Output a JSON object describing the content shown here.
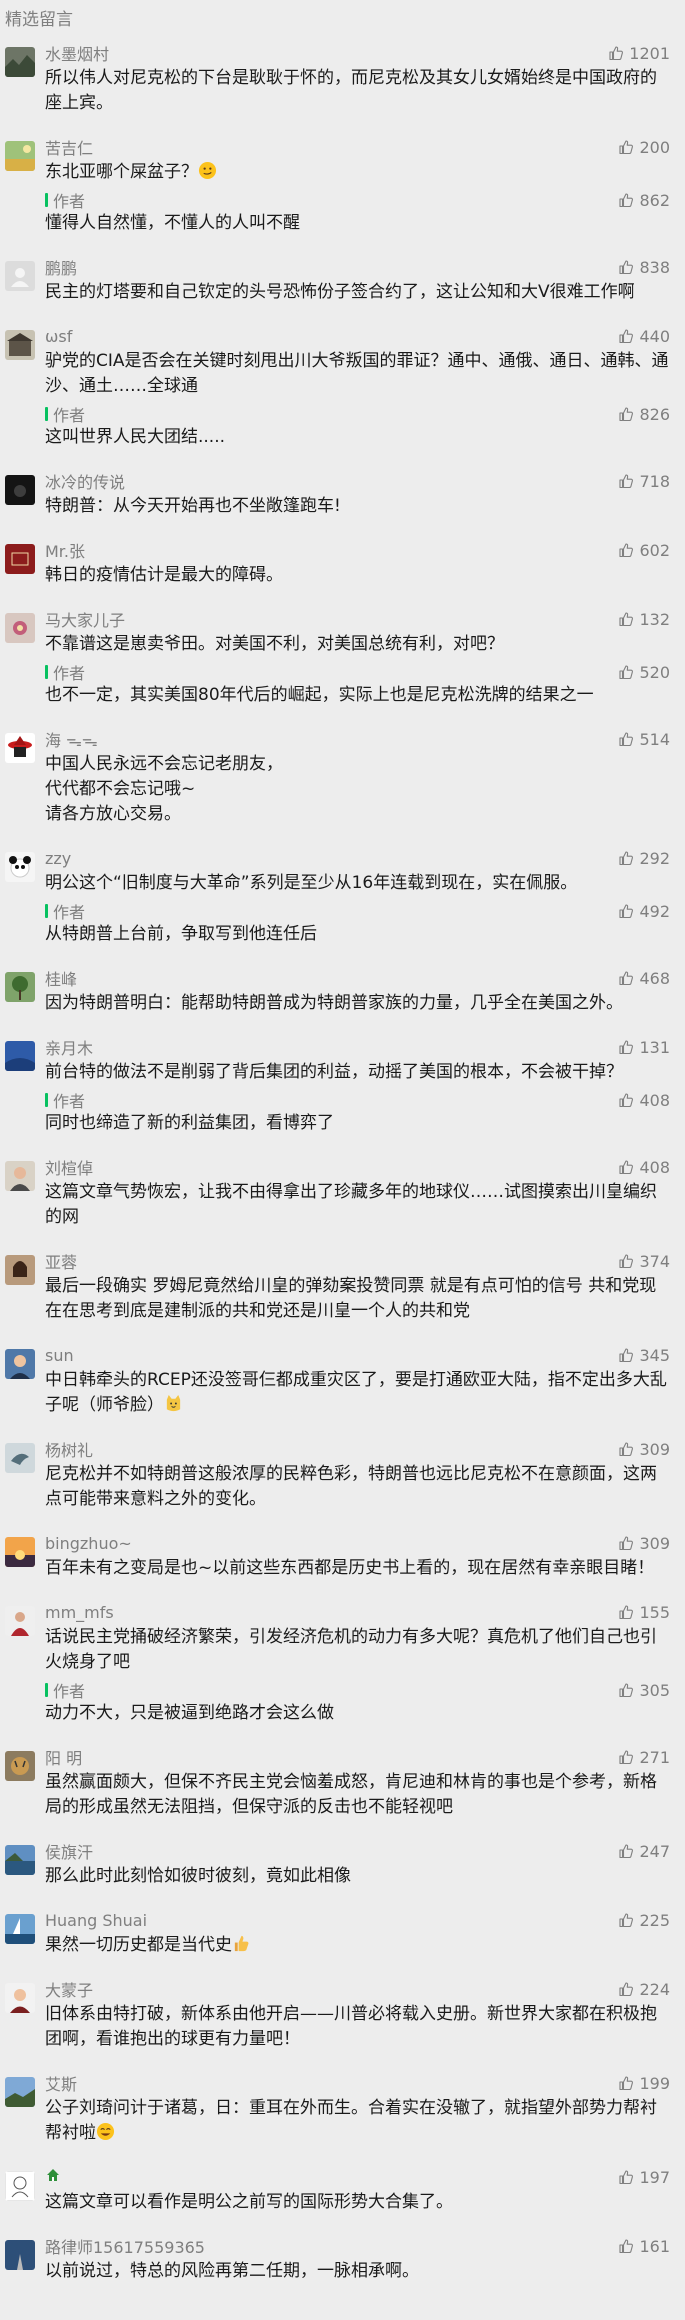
{
  "header": {
    "title": "精选留言"
  },
  "reply_author_label": "作者",
  "comments": [
    {
      "nick": "水墨烟村",
      "likes": "1201",
      "text": "所以伟人对尼克松的下台是耿耿于怀的，而尼克松及其女儿女婿始终是中国政府的座上宾。",
      "avatar": "landscape-avatar"
    },
    {
      "nick": "苦吉仁",
      "likes": "200",
      "text": "东北亚哪个屎盆子？",
      "emoji": "smirk-emoji",
      "reply": {
        "likes": "862",
        "text": "懂得人自然懂，不懂人的人叫不醒"
      },
      "avatar": "field-avatar"
    },
    {
      "nick": "鹏鹏",
      "likes": "838",
      "text": "民主的灯塔要和自己钦定的头号恐怖份子签合约了，这让公知和大V很难工作啊",
      "avatar": "default-avatar"
    },
    {
      "nick": "ωsf",
      "likes": "440",
      "text": "驴党的CIA是否会在关键时刻甩出川大爷叛国的罪证？通中、通俄、通日、通韩、通沙、通土……全球通",
      "reply": {
        "likes": "826",
        "text": "这叫世界人民大团结....."
      },
      "avatar": "building-avatar"
    },
    {
      "nick": "冰冷的传说",
      "likes": "718",
      "text": "特朗普：从今天开始再也不坐敞篷跑车!",
      "avatar": "dark-avatar"
    },
    {
      "nick": "Mr.张",
      "likes": "602",
      "text": "韩日的疫情估计是最大的障碍。",
      "avatar": "red-seal-avatar"
    },
    {
      "nick": "马大家儿子",
      "likes": "132",
      "text": "不靠谱这是崽卖爷田。对美国不利，对美国总统有利，对吧？",
      "reply": {
        "likes": "520",
        "text": "也不一定，其实美国80年代后的崛起，实际上也是尼克松洗牌的结果之一"
      },
      "avatar": "flower-avatar"
    },
    {
      "nick": "海 ᯓᯓ",
      "likes": "514",
      "text": "中国人民永远不会忘记老朋友，\n代代都不会忘记哦~\n请各方放心交易。",
      "avatar": "hat-avatar"
    },
    {
      "nick": "zzy",
      "likes": "292",
      "text": "明公这个“旧制度与大革命”系列是至少从16年连载到现在，实在佩服。",
      "reply": {
        "likes": "492",
        "text": "从特朗普上台前，争取写到他连任后"
      },
      "avatar": "panda-avatar"
    },
    {
      "nick": "桂峰",
      "likes": "468",
      "text": "因为特朗普明白：能帮助特朗普成为特朗普家族的力量，几乎全在美国之外。",
      "avatar": "tree-avatar"
    },
    {
      "nick": "亲月木",
      "likes": "131",
      "text": "前台特的做法不是削弱了背后集团的利益，动摇了美国的根本，不会被干掉？",
      "reply": {
        "likes": "408",
        "text": "同时也缔造了新的利益集团，看博弈了"
      },
      "avatar": "blue-avatar"
    },
    {
      "nick": "刘楦倬",
      "likes": "408",
      "text": "这篇文章气势恢宏，让我不由得拿出了珍藏多年的地球仪……试图摸索出川皇编织的网",
      "avatar": "person-avatar"
    },
    {
      "nick": "亚蓉",
      "likes": "374",
      "text": "最后一段确实 罗姆尼竟然给川皇的弹劾案投赞同票 就是有点可怕的信号 共和党现在在思考到底是建制派的共和党还是川皇一个人的共和党",
      "avatar": "woman-avatar"
    },
    {
      "nick": "sun",
      "likes": "345",
      "text": "中日韩牵头的RCEP还没签哥仨都成重灾区了，要是打通欧亚大陆，指不定出多大乱子呢（师爷脸）",
      "emoji": "cat-emoji",
      "avatar": "man-avatar"
    },
    {
      "nick": "杨树礼",
      "likes": "309",
      "text": "尼克松并不如特朗普这般浓厚的民粹色彩，特朗普也远比尼克松不在意颜面，这两点可能带来意料之外的变化。",
      "avatar": "bird-avatar"
    },
    {
      "nick": "bingzhuo~",
      "likes": "309",
      "text": "百年未有之变局是也~以前这些东西都是历史书上看的，现在居然有幸亲眼目睹！",
      "avatar": "sunset-avatar"
    },
    {
      "nick": "mm_mfs",
      "likes": "155",
      "text": "话说民主党捅破经济繁荣，引发经济危机的动力有多大呢？真危机了他们自己也引火烧身了吧",
      "reply": {
        "likes": "305",
        "text": "动力不大，只是被逼到绝路才会这么做"
      },
      "avatar": "lady-avatar"
    },
    {
      "nick": "阳 明",
      "likes": "271",
      "text": "虽然赢面颇大，但保不齐民主党会恼羞成怒，肯尼迪和林肯的事也是个参考，新格局的形成虽然无法阻挡，但保守派的反击也不能轻视吧",
      "avatar": "tiger-avatar"
    },
    {
      "nick": "侯旗汗",
      "likes": "247",
      "text": "那么此时此刻恰如彼时彼刻，竟如此相像",
      "avatar": "lake-avatar"
    },
    {
      "nick": "Huang Shuai",
      "likes": "225",
      "text": "果然一切历史都是当代史",
      "emoji": "thumb-emoji",
      "avatar": "sail-avatar"
    },
    {
      "nick": "大蒙子",
      "likes": "224",
      "text": "旧体系由特打破，新体系由他开启——川普必将载入史册。新世界大家都在积极抱团啊，看谁抱出的球更有力量吧！",
      "avatar": "guy-avatar"
    },
    {
      "nick": "艾斯",
      "likes": "199",
      "text": "公子刘琦问计于诸葛，日：重耳在外而生。合着实在没辙了，就指望外部势力帮衬帮衬啦",
      "emoji": "grin-emoji",
      "avatar": "sky-avatar"
    },
    {
      "nick": "",
      "likes": "197",
      "text": "这篇文章可以看作是明公之前写的国际形势大合集了。",
      "avatar": "sketch-avatar",
      "nick_icon": "house-icon"
    },
    {
      "nick": "路律师15617559365",
      "likes": "161",
      "text": "以前说过，特总的风险再第二任期，一脉相承啊。",
      "avatar": "road-avatar"
    }
  ],
  "colors": {
    "accent": "#07c160",
    "secondary_text": "#7f7f7f",
    "background": "#ededed"
  }
}
